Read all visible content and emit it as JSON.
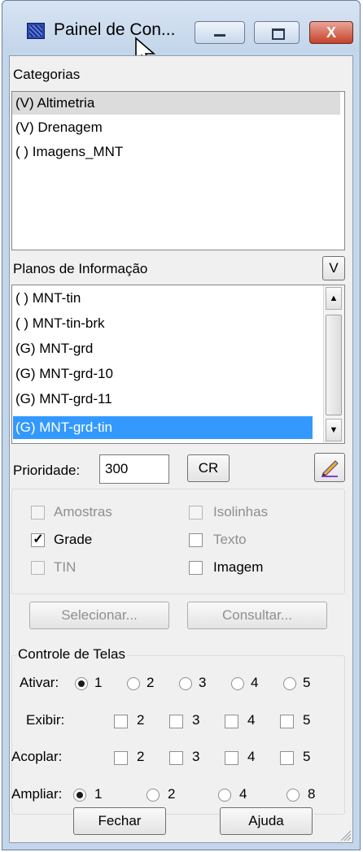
{
  "window": {
    "title": "Painel de Con...",
    "minimize_glyph": "",
    "maximize_glyph": "",
    "close_glyph": "X"
  },
  "categorias": {
    "label": "Categorias",
    "items": [
      "(V) Altimetria",
      "(V) Drenagem",
      "( ) Imagens_MNT"
    ],
    "selected_index": 0
  },
  "planos": {
    "label": "Planos de Informação",
    "v_button": "V",
    "items": [
      "( ) MNT-tin",
      "( ) MNT-tin-brk",
      "(G) MNT-grd",
      "(G) MNT-grd-10",
      "(G) MNT-grd-11",
      "(G) MNT-grd-tin"
    ],
    "selected_index": 5
  },
  "prioridade": {
    "label": "Prioridade:",
    "value": "300",
    "cr_button": "CR",
    "pencil_icon": "pencil-icon"
  },
  "representacoes": {
    "amostras": {
      "label": "Amostras",
      "checked": false,
      "enabled": false
    },
    "isolinhas": {
      "label": "Isolinhas",
      "checked": false,
      "enabled": false
    },
    "grade": {
      "label": "Grade",
      "checked": true,
      "enabled": true
    },
    "texto": {
      "label": "Texto",
      "checked": false,
      "enabled": true
    },
    "tin": {
      "label": "TIN",
      "checked": false,
      "enabled": false
    },
    "imagem": {
      "label": "Imagem",
      "checked": false,
      "enabled": true
    }
  },
  "actions": {
    "selecionar": "Selecionar...",
    "consultar": "Consultar..."
  },
  "controle": {
    "title": "Controle de Telas",
    "ativar": {
      "label": "Ativar:",
      "options": [
        "1",
        "2",
        "3",
        "4",
        "5"
      ],
      "selected": "1"
    },
    "exibir": {
      "label": "Exibir:",
      "options": [
        "2",
        "3",
        "4",
        "5"
      ]
    },
    "acoplar": {
      "label": "Acoplar:",
      "options": [
        "2",
        "3",
        "4",
        "5"
      ]
    },
    "ampliar": {
      "label": "Ampliar:",
      "options": [
        "1",
        "2",
        "4",
        "8"
      ],
      "selected": "1"
    }
  },
  "footer": {
    "fechar": "Fechar",
    "ajuda": "Ajuda"
  },
  "colors": {
    "selection": "#3399ff",
    "titlebar": "#c4d6ec",
    "close_button": "#c7422a"
  }
}
